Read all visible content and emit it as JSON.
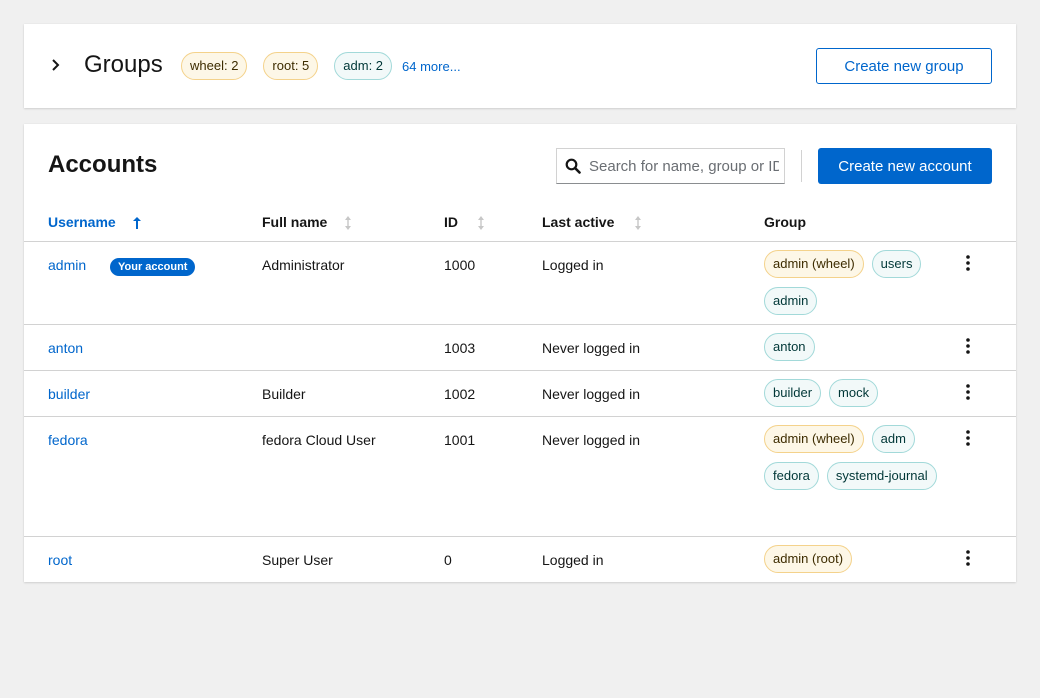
{
  "groups_section": {
    "title": "Groups",
    "chips": [
      {
        "label": "wheel: 2",
        "color": "gold"
      },
      {
        "label": "root: 5",
        "color": "gold"
      },
      {
        "label": "adm: 2",
        "color": "cyan"
      }
    ],
    "more_link": "64 more...",
    "create_button": "Create new group"
  },
  "accounts_section": {
    "title": "Accounts",
    "search_placeholder": "Search for name, group or ID",
    "create_button": "Create new account",
    "columns": {
      "username": "Username",
      "full_name": "Full name",
      "id": "ID",
      "last_active": "Last active",
      "group": "Group"
    },
    "your_account_badge": "Your account",
    "rows": [
      {
        "username": "admin",
        "full_name": "Administrator",
        "id": "1000",
        "last_active": "Logged in",
        "groups": [
          {
            "label": "admin (wheel)",
            "color": "gold"
          },
          {
            "label": "users",
            "color": "cyan"
          },
          {
            "label": "admin",
            "color": "cyan"
          }
        ]
      },
      {
        "username": "anton",
        "full_name": "",
        "id": "1003",
        "last_active": "Never logged in",
        "groups": [
          {
            "label": "anton",
            "color": "cyan"
          }
        ]
      },
      {
        "username": "builder",
        "full_name": "Builder",
        "id": "1002",
        "last_active": "Never logged in",
        "groups": [
          {
            "label": "builder",
            "color": "cyan"
          },
          {
            "label": "mock",
            "color": "cyan"
          }
        ]
      },
      {
        "username": "fedora",
        "full_name": "fedora Cloud User",
        "id": "1001",
        "last_active": "Never logged in",
        "groups": [
          {
            "label": "admin (wheel)",
            "color": "gold"
          },
          {
            "label": "adm",
            "color": "cyan"
          },
          {
            "label": "fedora",
            "color": "cyan"
          },
          {
            "label": "systemd-journal",
            "color": "cyan"
          }
        ]
      },
      {
        "username": "root",
        "full_name": "Super User",
        "id": "0",
        "last_active": "Logged in",
        "groups": [
          {
            "label": "admin (root)",
            "color": "gold"
          }
        ]
      }
    ]
  },
  "colors": {
    "primary": "#0066cc",
    "gold_chip_bg": "#fdf7e7",
    "cyan_chip_bg": "#f2f9f9"
  }
}
